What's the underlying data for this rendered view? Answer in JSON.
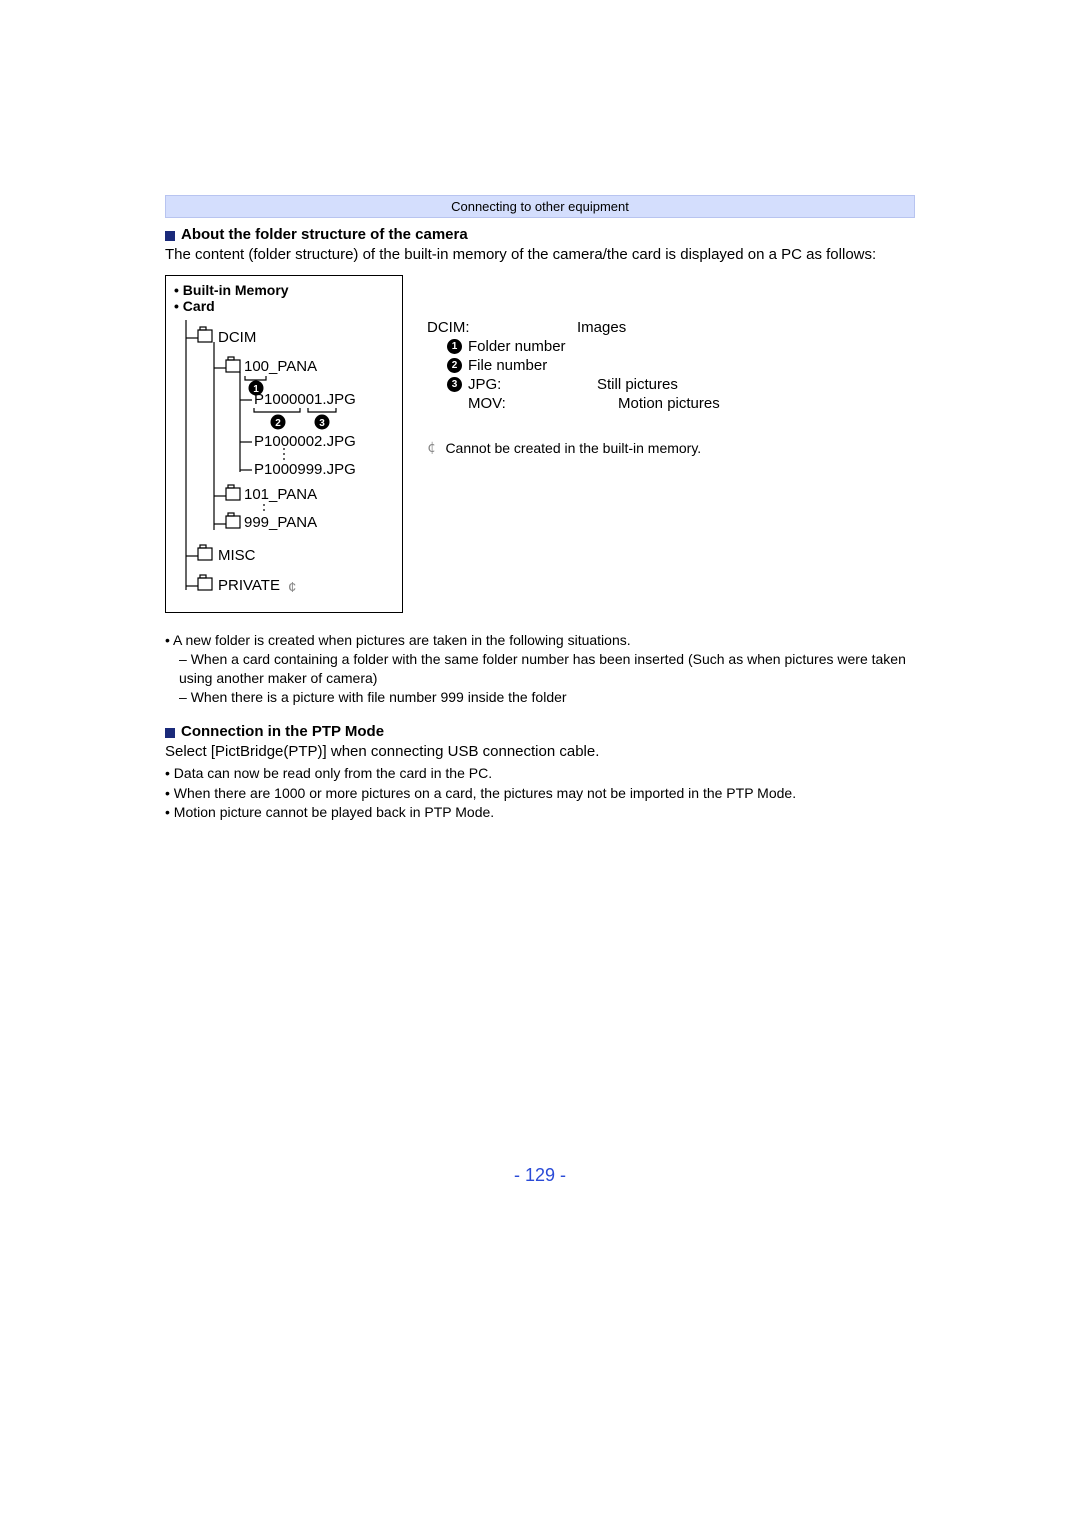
{
  "breadcrumb": "Connecting to other equipment",
  "section1": {
    "title": "About the folder structure of the camera",
    "intro": "The content (folder structure) of the built-in memory of the camera/the card is displayed on a PC as follows:"
  },
  "treebox": {
    "line1": "Built-in Memory",
    "line2": "Card"
  },
  "tree": {
    "dcim": "DCIM",
    "f100": "100_PANA",
    "p1": "P1000001.JPG",
    "p2": "P1000002.JPG",
    "p999": "P1000999.JPG",
    "f101": "101_PANA",
    "f999": "999_PANA",
    "misc": "MISC",
    "private": "PRIVATE",
    "asterisk": "¢"
  },
  "callouts": {
    "c1": "1",
    "c2": "2",
    "c3": "3"
  },
  "legend": {
    "dcim_l": "DCIM:",
    "dcim_r": "Images",
    "n1": "Folder number",
    "n2": "File number",
    "jpg_l": "JPG:",
    "jpg_r": "Still pictures",
    "mov_l": "MOV:",
    "mov_r": "Motion pictures",
    "star_note": "Cannot be created in the built-in memory."
  },
  "bullets1": {
    "b1": "A new folder is created when pictures are taken in the following situations.",
    "b2a": "When a card containing a folder with the same folder number has been inserted (Such as when pictures were taken using another maker of camera)",
    "b2b": "When there is a picture with file number 999 inside the folder"
  },
  "section2": {
    "title": "Connection in the PTP Mode",
    "intro": "Select [PictBridge(PTP)] when connecting USB connection cable.",
    "b1": "Data can now be read only from the card in the PC.",
    "b2": "When there are 1000 or more pictures on a card, the pictures may not be imported in the PTP Mode.",
    "b3": "Motion picture cannot be played back in PTP Mode."
  },
  "page_number": "- 129 -"
}
